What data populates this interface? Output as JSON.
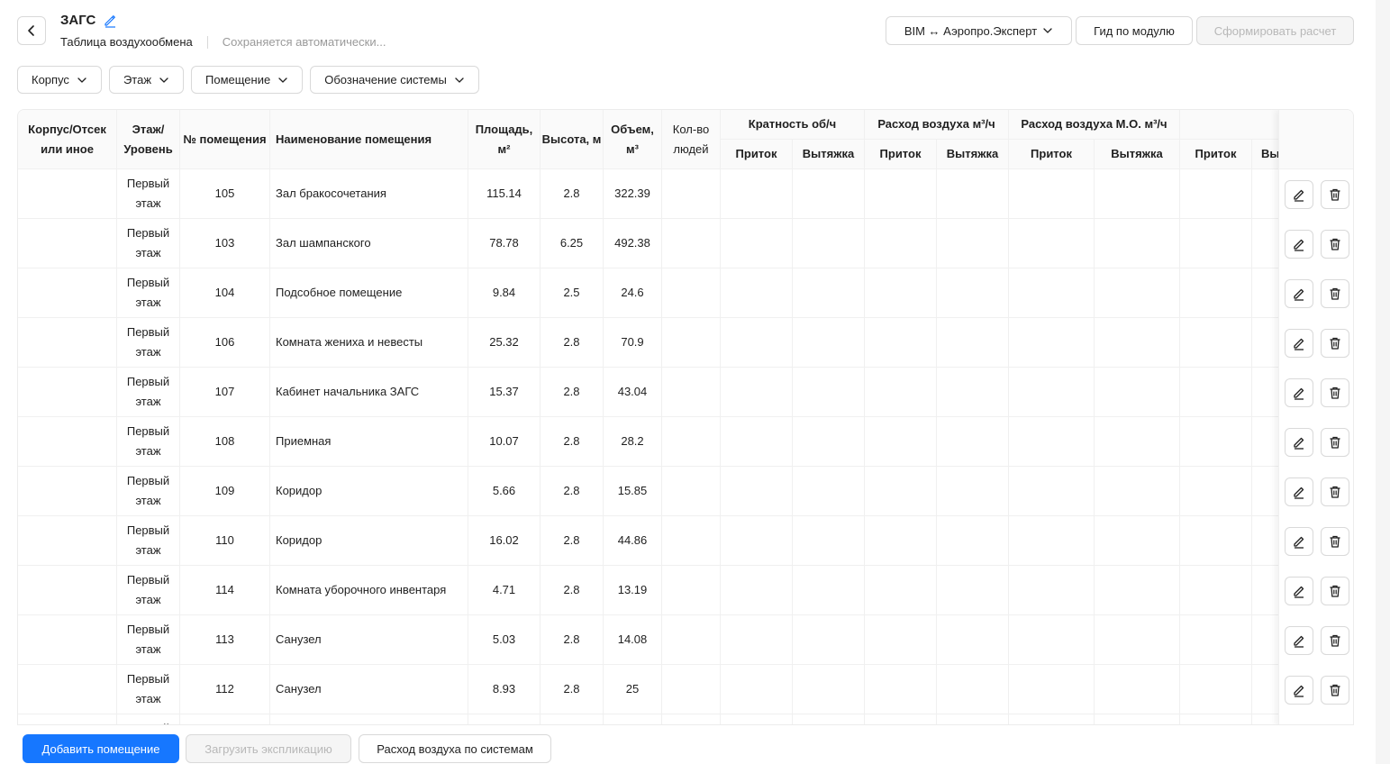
{
  "header": {
    "title": "ЗАГС",
    "subtitle": "Таблица воздухообмена",
    "autosave": "Сохраняется автоматически...",
    "bim_button": "BIM ↔ Аэропро.Эксперт",
    "guide_button": "Гид по модулю",
    "calc_button": "Сформировать расчет"
  },
  "filters": [
    "Корпус",
    "Этаж",
    "Помещение",
    "Обозначение системы"
  ],
  "table": {
    "columns": {
      "building": "Корпус/Отсек или иное",
      "floor": "Этаж/ Уровень",
      "room_no": "№ помещения",
      "room_name": "Наименование помещения",
      "area": "Площадь, м²",
      "height": "Высота, м",
      "volume": "Объем, м³",
      "people": "Кол-во людей",
      "group_multiplicity": "Кратность об/ч",
      "group_airflow": "Расход воздуха м³/ч",
      "group_airflow_mo": "Расход воздуха М.О. м³/ч",
      "supply": "Приток",
      "exhaust": "Вытяжка",
      "exhaust_cut": "Вы"
    },
    "rows": [
      {
        "building": "",
        "floor": "Первый этаж",
        "room_no": "105",
        "name": "Зал бракосочетания",
        "area": "115.14",
        "height": "2.8",
        "volume": "322.39"
      },
      {
        "building": "",
        "floor": "Первый этаж",
        "room_no": "103",
        "name": "Зал шампанского",
        "area": "78.78",
        "height": "6.25",
        "volume": "492.38"
      },
      {
        "building": "",
        "floor": "Первый этаж",
        "room_no": "104",
        "name": "Подсобное помещение",
        "area": "9.84",
        "height": "2.5",
        "volume": "24.6"
      },
      {
        "building": "",
        "floor": "Первый этаж",
        "room_no": "106",
        "name": "Комната жениха и невесты",
        "area": "25.32",
        "height": "2.8",
        "volume": "70.9"
      },
      {
        "building": "",
        "floor": "Первый этаж",
        "room_no": "107",
        "name": "Кабинет начальника ЗАГС",
        "area": "15.37",
        "height": "2.8",
        "volume": "43.04"
      },
      {
        "building": "",
        "floor": "Первый этаж",
        "room_no": "108",
        "name": "Приемная",
        "area": "10.07",
        "height": "2.8",
        "volume": "28.2"
      },
      {
        "building": "",
        "floor": "Первый этаж",
        "room_no": "109",
        "name": "Коридор",
        "area": "5.66",
        "height": "2.8",
        "volume": "15.85"
      },
      {
        "building": "",
        "floor": "Первый этаж",
        "room_no": "110",
        "name": "Коридор",
        "area": "16.02",
        "height": "2.8",
        "volume": "44.86"
      },
      {
        "building": "",
        "floor": "Первый этаж",
        "room_no": "114",
        "name": "Комната уборочного инвентаря",
        "area": "4.71",
        "height": "2.8",
        "volume": "13.19"
      },
      {
        "building": "",
        "floor": "Первый этаж",
        "room_no": "113",
        "name": "Санузел",
        "area": "5.03",
        "height": "2.8",
        "volume": "14.08"
      },
      {
        "building": "",
        "floor": "Первый этаж",
        "room_no": "112",
        "name": "Санузел",
        "area": "8.93",
        "height": "2.8",
        "volume": "25"
      },
      {
        "building": "",
        "floor": "Первый этаж",
        "room_no": "",
        "name": "",
        "area": "",
        "height": "",
        "volume": ""
      }
    ]
  },
  "bottom": {
    "add_room": "Добавить помещение",
    "load_explication": "Загрузить экспликацию",
    "airflow_by_systems": "Расход воздуха по системам"
  },
  "colors": {
    "primary": "#1677ff",
    "border": "#d9d9d9",
    "header_bg": "#fafafa"
  },
  "icons": [
    "back-arrow-icon",
    "pencil-icon",
    "chevron-down-icon",
    "edit-icon",
    "trash-icon"
  ]
}
